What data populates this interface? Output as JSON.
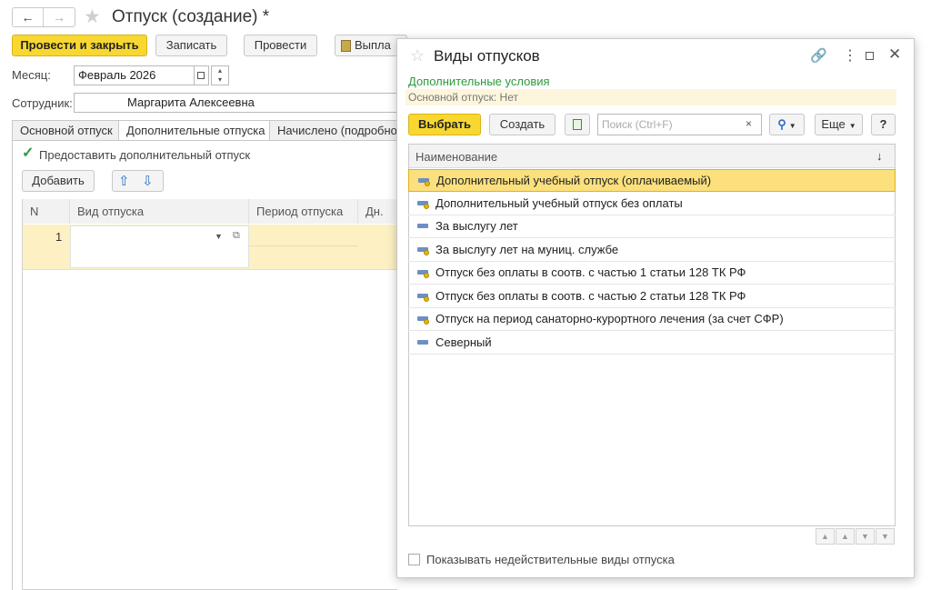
{
  "window": {
    "title": "Отпуск (создание) *",
    "back_icon": "←",
    "forward_icon": "→",
    "star_icon": "★"
  },
  "toolbar": {
    "post_close": "Провести и закрыть",
    "save": "Записать",
    "post": "Провести",
    "pay": "Выпла"
  },
  "form": {
    "month_label": "Месяц:",
    "month_value": "Февраль 2026",
    "employee_label": "Сотрудник:",
    "employee_value": "Маргарита Алексеевна"
  },
  "tabs": [
    "Основной отпуск",
    "Дополнительные отпуска",
    "Начислено (подробно)"
  ],
  "extra": {
    "checkbox_label": "Предоставить дополнительный отпуск",
    "checkbox_checked": true,
    "add_button": "Добавить"
  },
  "table": {
    "columns": [
      "N",
      "Вид отпуска",
      "Период отпуска",
      "Дн."
    ],
    "rows": [
      {
        "n": "1",
        "type": "",
        "period": ""
      }
    ]
  },
  "dialog": {
    "title": "Виды отпусков",
    "extra_conditions": "Дополнительные условия",
    "main_leave": "Основной отпуск: Нет",
    "select_button": "Выбрать",
    "create_button": "Создать",
    "search_placeholder": "Поиск (Ctrl+F)",
    "more_button": "Еще",
    "help_button": "?",
    "column_header": "Наименование",
    "sort_indicator": "↓",
    "items": [
      "Дополнительный учебный отпуск (оплачиваемый)",
      "Дополнительный учебный отпуск без оплаты",
      "За выслугу лет",
      "За выслугу лет на муниц. службе",
      "Отпуск без оплаты в соотв. с частью 1 статьи 128 ТК РФ",
      "Отпуск без оплаты в соотв. с частью 2 статьи 128 ТК РФ",
      "Отпуск на период санаторно-курортного лечения (за счет СФР)",
      "Северный"
    ],
    "selected_index": 0,
    "show_invalid_label": "Показывать недействительные виды отпуска",
    "show_invalid_checked": false
  },
  "colors": {
    "accent_yellow": "#f8d830",
    "selected_row": "#fbe07d",
    "green_text": "#2e9a3e",
    "info_bg": "#fdf6dc"
  }
}
